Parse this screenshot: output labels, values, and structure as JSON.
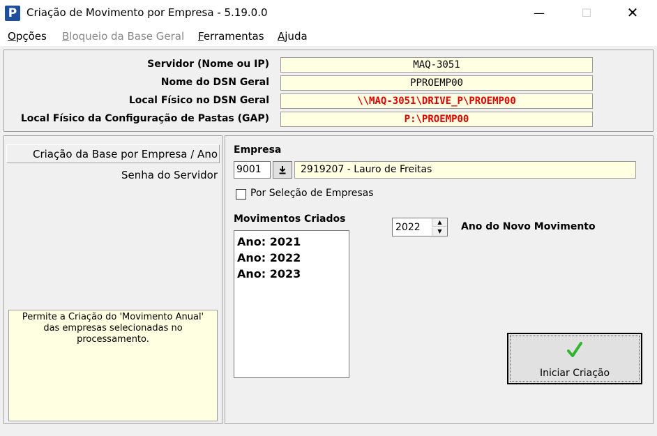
{
  "window": {
    "title": "Criação de Movimento por Empresa - 5.19.0.0",
    "icon_letter": "P",
    "minimize_glyph": "—",
    "maximize_glyph": "☐",
    "close_glyph": "✕"
  },
  "menu": {
    "items": [
      {
        "label": "Opções",
        "mnemonic": "O",
        "rest": "pções",
        "enabled": true
      },
      {
        "label": "Bloqueio da Base Geral",
        "mnemonic": "B",
        "rest": "loqueio da Base Geral",
        "enabled": false
      },
      {
        "label": "Ferramentas",
        "mnemonic": "F",
        "rest": "erramentas",
        "enabled": true
      },
      {
        "label": "Ajuda",
        "mnemonic": "A",
        "rest": "juda",
        "enabled": true
      }
    ]
  },
  "server": {
    "rows": [
      {
        "label": "Servidor (Nome ou IP)",
        "value": "MAQ-3051"
      },
      {
        "label": "Nome do DSN Geral",
        "value": "PPROEMP00"
      },
      {
        "label": "Local Físico no DSN Geral",
        "value": "\\\\MAQ-3051\\DRIVE_P\\PROEMP00"
      },
      {
        "label": "Local Físico da Configuração de Pastas (GAP)",
        "value": "P:\\PROEMP00"
      }
    ],
    "highlight_color": "#e00000"
  },
  "nav": {
    "items": [
      {
        "label": "Criação da Base por Empresa / Ano",
        "selected": true
      },
      {
        "label": "Senha do Servidor",
        "selected": false
      }
    ],
    "hint": "Permite a Criação do 'Movimento Anual' das empresas selecionadas no processamento."
  },
  "empresa": {
    "label": "Empresa",
    "code": "9001",
    "lookup_icon": "download-arrow-icon",
    "name": "2919207 - Lauro de Freitas",
    "multi_select_label": "Por Seleção de Empresas"
  },
  "movimentos": {
    "label": "Movimentos Criados",
    "items": [
      "Ano: 2021",
      "Ano: 2022",
      "Ano: 2023"
    ]
  },
  "novo_ano": {
    "value": "2022",
    "label": "Ano do Novo Movimento"
  },
  "action": {
    "label": "Iniciar Criação",
    "icon": "green-check-icon",
    "icon_color": "#2fb52f"
  },
  "colors": {
    "info_bg": "#ffffe1",
    "window_bg": "#f0f0f0",
    "app_icon": "#1f4e9b"
  }
}
